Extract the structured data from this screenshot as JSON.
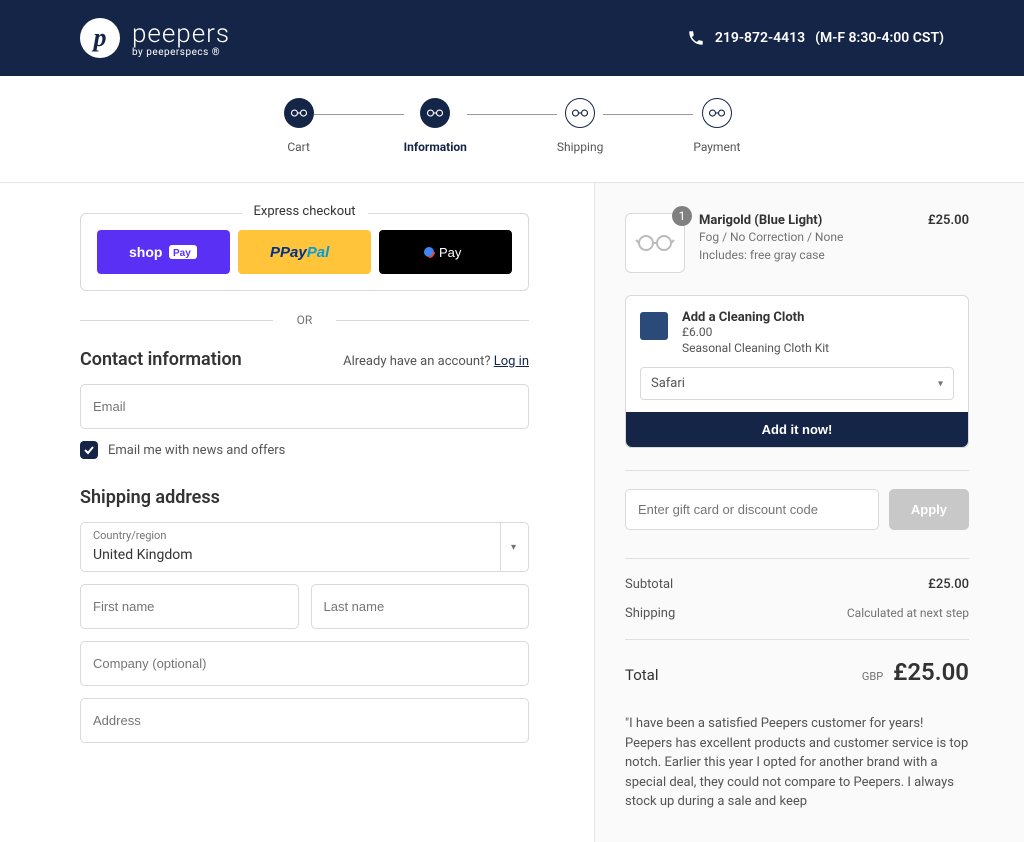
{
  "header": {
    "brand": "peepers",
    "tagline": "by peeperspecs ®",
    "phone": "219-872-4413",
    "hours": "(M-F 8:30-4:00 CST)"
  },
  "progress": {
    "steps": [
      "Cart",
      "Information",
      "Shipping",
      "Payment"
    ]
  },
  "express": {
    "title": "Express checkout",
    "or": "OR"
  },
  "contact": {
    "title": "Contact information",
    "already": "Already have an account?",
    "login": "Log in",
    "email_placeholder": "Email",
    "news_label": "Email me with news and offers"
  },
  "shipping": {
    "title": "Shipping address",
    "country_label": "Country/region",
    "country_value": "United Kingdom",
    "first_name": "First name",
    "last_name": "Last name",
    "company": "Company (optional)",
    "address": "Address"
  },
  "cart": {
    "item": {
      "name": "Marigold (Blue Light)",
      "variant": "Fog / No Correction / None",
      "includes": "Includes: free gray case",
      "price": "£25.00",
      "qty": "1"
    },
    "upsell": {
      "title": "Add a Cleaning Cloth",
      "price": "£6.00",
      "desc": "Seasonal Cleaning Cloth Kit",
      "option": "Safari",
      "button": "Add it now!"
    },
    "discount_placeholder": "Enter gift card or discount code",
    "apply": "Apply",
    "subtotal_label": "Subtotal",
    "subtotal_value": "£25.00",
    "shipping_label": "Shipping",
    "shipping_value": "Calculated at next step",
    "total_label": "Total",
    "currency": "GBP",
    "total_value": "£25.00",
    "testimonial": "\"I have been a satisfied Peepers customer for years! Peepers has excellent products and customer service is top notch. Earlier this year I opted for another brand with a special deal, they could not compare to Peepers. I always stock up during a sale and keep"
  }
}
